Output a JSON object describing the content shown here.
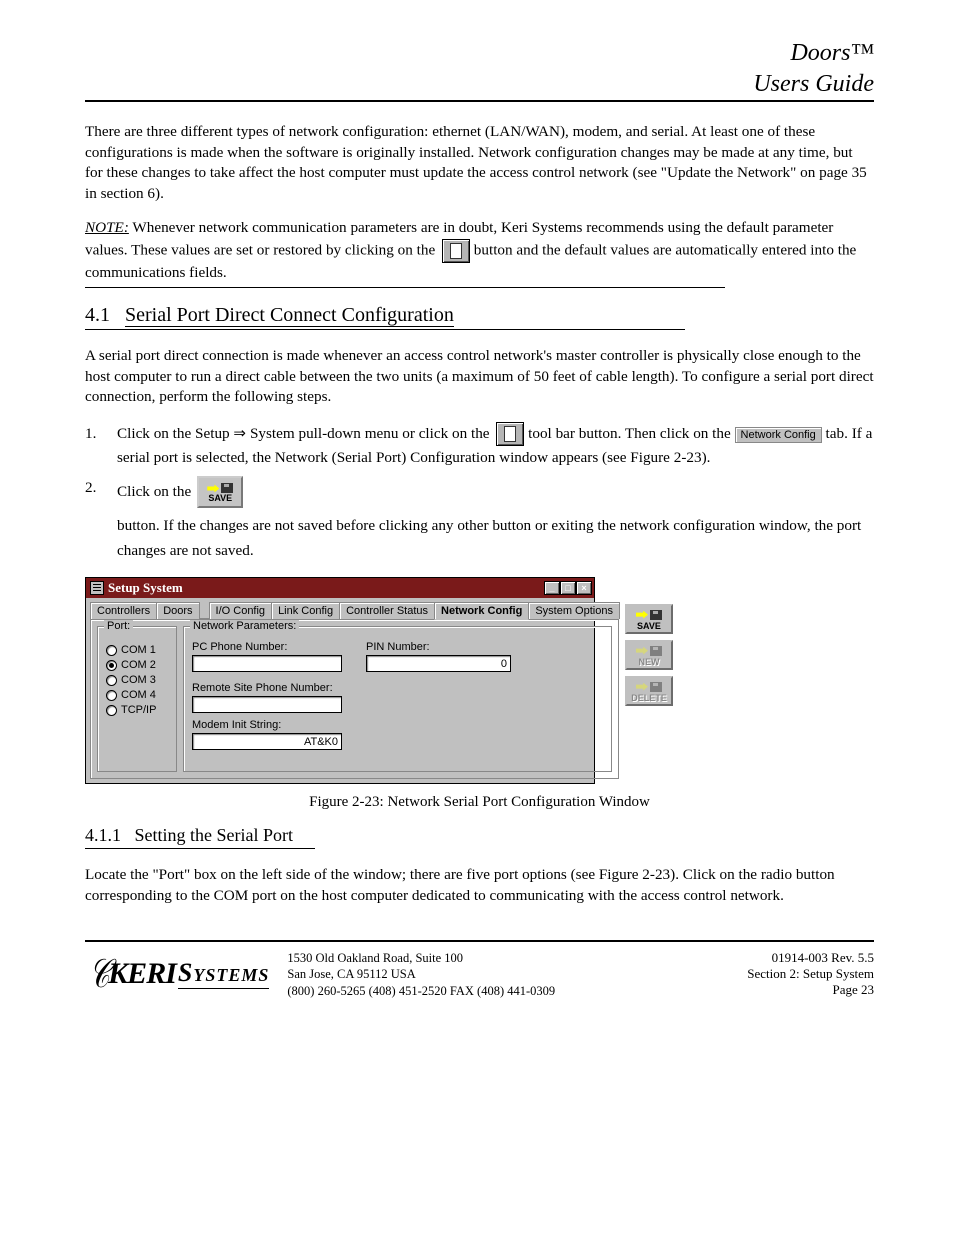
{
  "header": {
    "line1": "Doors™",
    "line2": "Users Guide"
  },
  "intro": "There are three different types of network configuration: ethernet (LAN/WAN), modem, and serial. At least one of these configurations is made when the software is originally installed. Network configuration changes may be made at any time, but for these changes to take affect the host computer must update the access control network (see \"Update the Network\" on page 35 in section 6).",
  "note": {
    "label": "NOTE:",
    "text": "Whenever network communication parameters are in doubt, Keri Systems recommends using the default parameter values. These values are set or restored by clicking on the",
    "text2": "button and the default values are automatically entered into the communications fields."
  },
  "section": {
    "num": "4.1",
    "title": "Serial Port Direct Connect Configuration",
    "body": "A serial port direct connection is made whenever an access control network's master controller is physically close enough to the host computer to run a direct cable between the two units (a maximum of 50 feet of cable length). To configure a serial port direct connection, perform the following steps."
  },
  "steps": {
    "s1_a": "Click on the Setup ⇒ System pull-down menu or click on the",
    "s1_b": "tool bar button. Then click on the",
    "s1_c": "tab. If a serial port is selected, the Network (Serial Port) Configuration window appears (see Figure 2-23).",
    "tabname": "Network Config",
    "s2_a": "Click on the",
    "s2_b": " button. If the changes are not saved before clicking any other button or exiting the network configuration window, the port changes are not saved.",
    "save": "SAVE"
  },
  "figcap": "Figure 2-23: Network Serial Port Configuration Window",
  "sub": {
    "num": "4.1.1",
    "title": "Setting the Serial Port",
    "body": "Locate the \"Port\" box on the left side of the window; there are five port options (see Figure 2-23). Click on the radio button corresponding to the COM port on the host computer dedicated to communicating with the access control network."
  },
  "window": {
    "title": "Setup System",
    "tabs": {
      "controllers": "Controllers",
      "doors": "Doors",
      "io": "I/O Config",
      "link": "Link Config",
      "cstatus": "Controller Status",
      "net": "Network Config",
      "sys": "System Options"
    },
    "port": {
      "legend": "Port:",
      "com1": "COM 1",
      "com2": "COM 2",
      "com3": "COM 3",
      "com4": "COM 4",
      "tcpip": "TCP/IP"
    },
    "np": {
      "legend": "Network Parameters:",
      "pcphone": "PC Phone Number:",
      "pin": "PIN Number:",
      "pinval": "0",
      "remote": "Remote Site Phone Number:",
      "modem": "Modem Init String:",
      "modemval": "AT&K0"
    },
    "buttons": {
      "save": "SAVE",
      "new": "NEW",
      "delete": "DELETE"
    },
    "winbtns": {
      "min": "_",
      "max": "□",
      "close": "×"
    }
  },
  "footer": {
    "addr1": "1530 Old Oakland Road, Suite 100",
    "addr2": "San Jose, CA 95112 USA",
    "addr3": "(800) 260-5265 (408) 451-2520 FAX (408) 441-0309",
    "doc1": "01914-003 Rev. 5.5",
    "doc2": "Section 2: Setup System",
    "page": "Page 23"
  }
}
